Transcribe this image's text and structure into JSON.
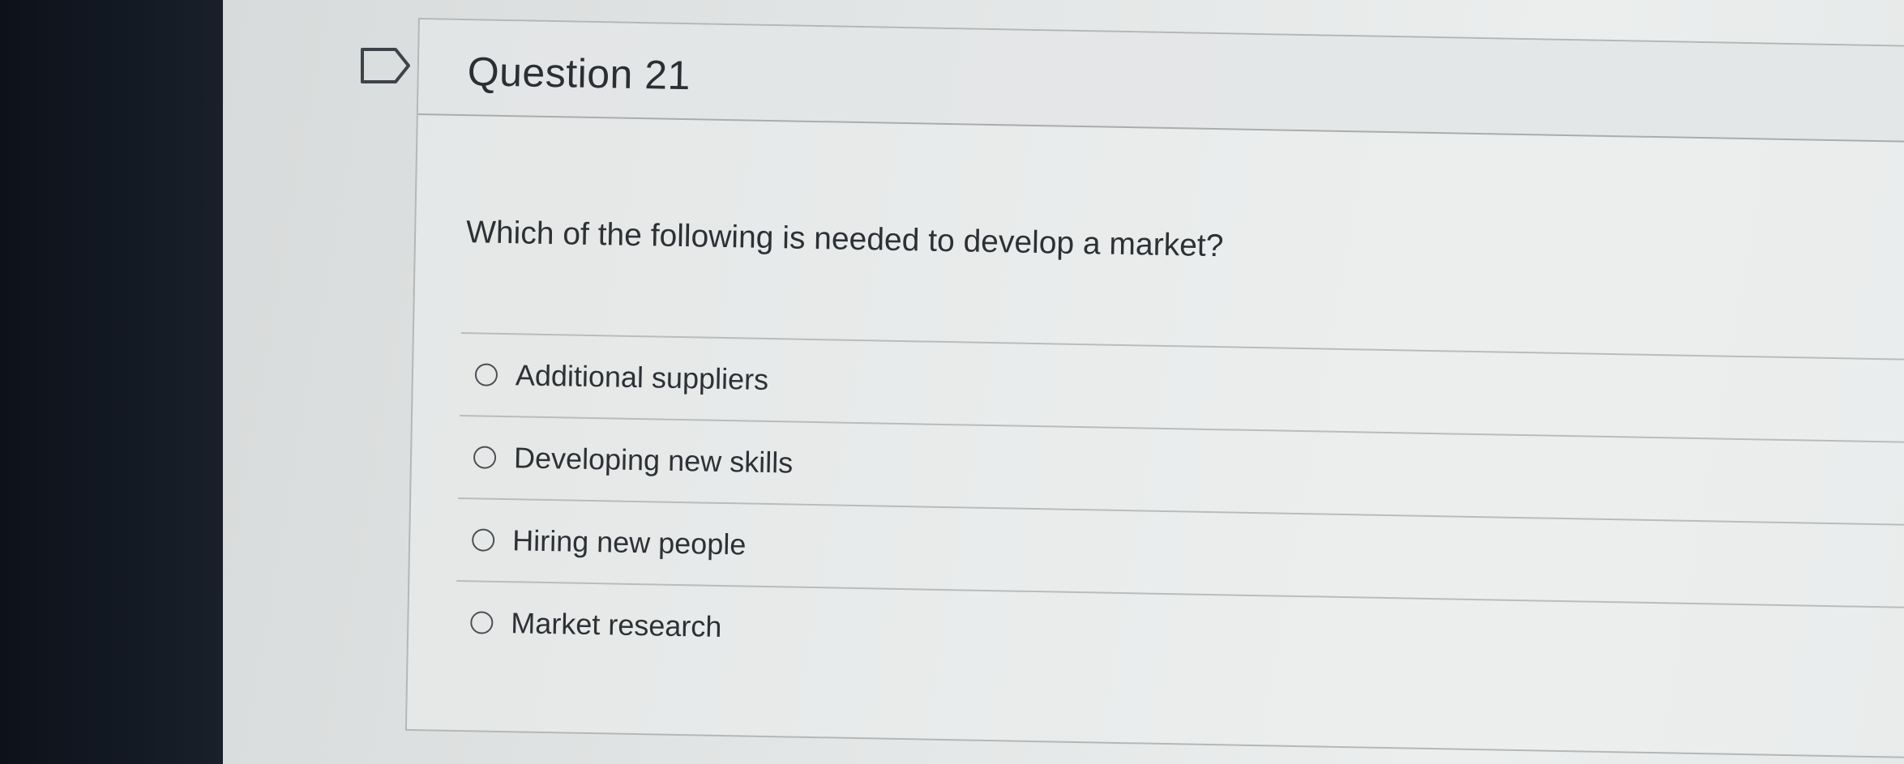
{
  "question": {
    "title": "Question 21",
    "text": "Which of the following is needed to develop a market?",
    "options": [
      {
        "label": "Additional suppliers",
        "selected": false
      },
      {
        "label": "Developing new skills",
        "selected": false
      },
      {
        "label": "Hiring new people",
        "selected": false
      },
      {
        "label": "Market research",
        "selected": false
      }
    ]
  },
  "icons": {
    "flag": "flag-question-icon",
    "radio": "radio-button-unselected"
  },
  "colors": {
    "bezel": "#131923",
    "screen": "#e3e6e6",
    "text": "#2d3135",
    "divider": "#b8bcbd"
  }
}
